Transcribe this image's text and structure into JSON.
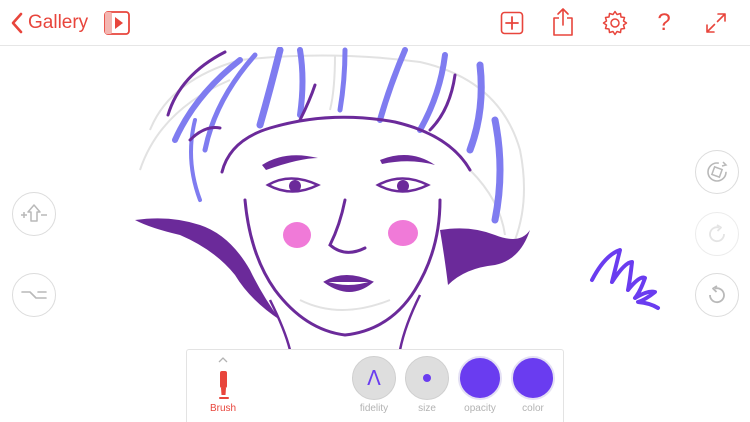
{
  "topbar": {
    "back_label": "Gallery",
    "icons": [
      "chevron-left-icon",
      "play-icon",
      "plus-icon",
      "share-icon",
      "gear-icon",
      "help-icon",
      "expand-icon"
    ],
    "help_glyph": "?",
    "accent_color": "#e8453c"
  },
  "drawing": {
    "brush_color": "#6a3cf0",
    "hair_accent_color": "#7f7cf0",
    "cheek_color": "#f07ad8",
    "outline_color": "#6b2a9a"
  },
  "side_controls": {
    "left": [
      "symmetry-icon",
      "snap-icon"
    ],
    "right": [
      "rotate-canvas-icon",
      "redo-icon",
      "undo-icon"
    ]
  },
  "tool_panel": {
    "tool_label": "Brush",
    "fidelity_label": "fidelity",
    "fidelity_glyph": "Λ",
    "size_label": "size",
    "opacity_label": "opacity",
    "color_label": "color",
    "selected_color": "#6a3cf0"
  }
}
